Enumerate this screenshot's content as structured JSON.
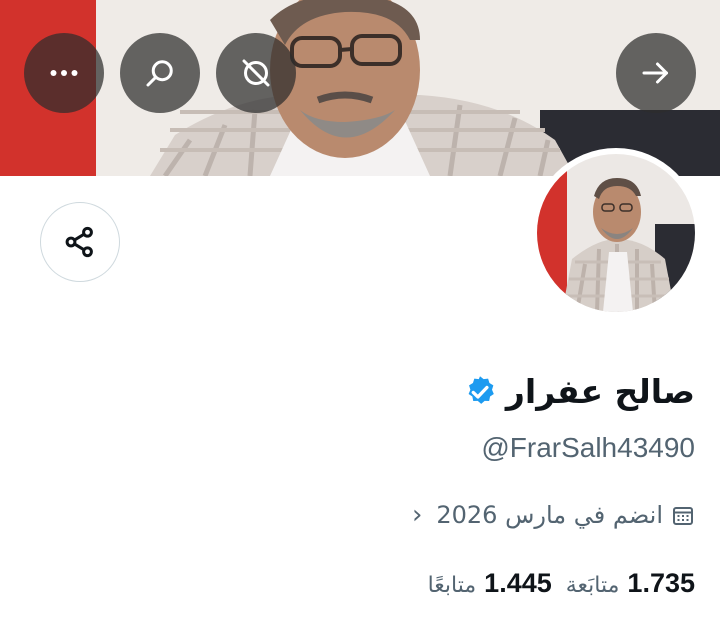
{
  "profile": {
    "display_name": "صالح عفرار",
    "handle": "@FrarSalh43490",
    "joined": "انضم في مارس 2026",
    "following_count": "1.735",
    "following_label": "متابَعة",
    "followers_count": "1.445",
    "followers_label": "متابعًا",
    "verified": true
  },
  "icons": {
    "more": "more-horizontal-icon",
    "search": "search-icon",
    "grok": "grok-icon",
    "forward": "arrow-right-icon",
    "share": "share-icon",
    "verified": "verified-badge-icon",
    "calendar": "calendar-icon",
    "chevron": "chevron-left-icon"
  },
  "colors": {
    "verified_blue": "#1d9bf0",
    "secondary_text": "#536471",
    "primary_text": "#0f1419"
  }
}
